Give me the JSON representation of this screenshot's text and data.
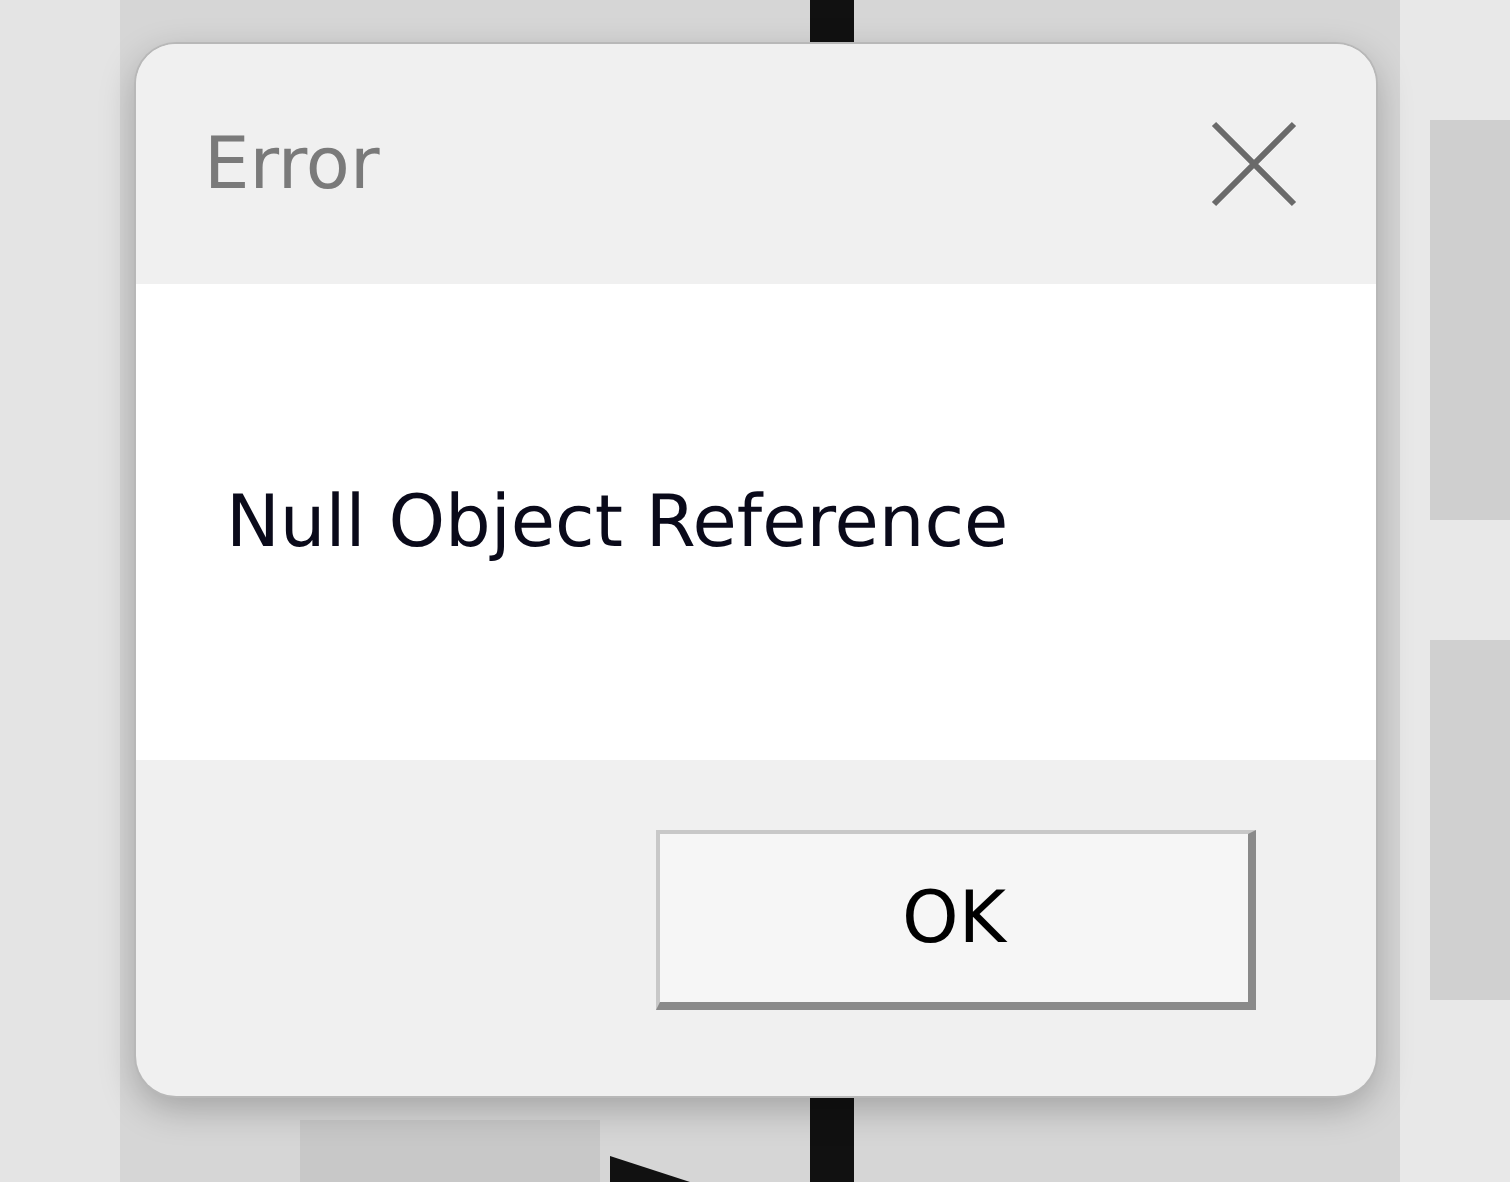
{
  "dialog": {
    "title": "Error",
    "message": "Null Object Reference",
    "buttons": [
      "OK"
    ]
  }
}
